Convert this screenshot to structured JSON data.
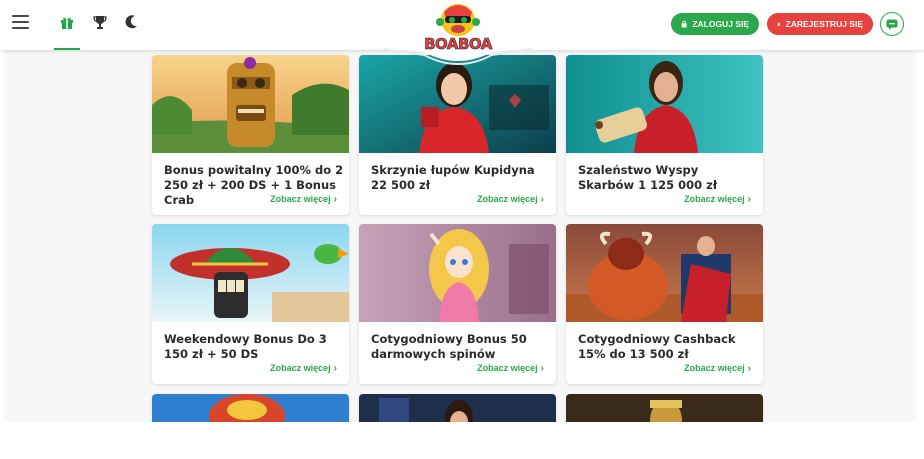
{
  "header": {
    "login_label": "ZALOGUJ SIĘ",
    "register_label": "ZAREJESTRUJ SIĘ",
    "logo_text": "BOABOA",
    "nav_icons": [
      "gift-icon",
      "trophy-icon",
      "moon-icon"
    ]
  },
  "colors": {
    "accent_green": "#2aa84a",
    "accent_red": "#e8413f"
  },
  "promotions": [
    {
      "title": "Bonus powitalny 100% do 2 250 zł + 200 DS + 1 Bonus Crab",
      "more": "Zobacz więcej"
    },
    {
      "title": "Skrzynie łupów Kupidyna 22 500 zł",
      "more": "Zobacz więcej"
    },
    {
      "title": "Szaleństwo Wyspy Skarbów 1 125 000 zł",
      "more": "Zobacz więcej"
    },
    {
      "title": "Weekendowy Bonus Do 3 150 zł + 50 DS",
      "more": "Zobacz więcej"
    },
    {
      "title": "Cotygodniowy Bonus 50 darmowych spinów",
      "more": "Zobacz więcej"
    },
    {
      "title": "Cotygodniowy Cashback 15% do 13 500 zł",
      "more": "Zobacz więcej"
    }
  ]
}
